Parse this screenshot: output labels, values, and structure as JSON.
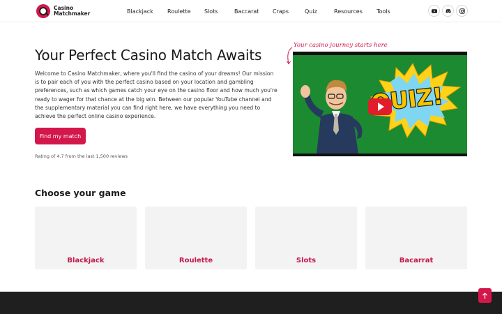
{
  "brand": {
    "name": "Casino Matchmaker",
    "accent": "#d4174b"
  },
  "nav": {
    "items": [
      {
        "label": "Blackjack"
      },
      {
        "label": "Roulette"
      },
      {
        "label": "Slots"
      },
      {
        "label": "Baccarat"
      },
      {
        "label": "Craps"
      },
      {
        "label": "Quiz"
      },
      {
        "label": "Resources"
      },
      {
        "label": "Tools"
      }
    ],
    "social": [
      "youtube-icon",
      "discord-icon",
      "instagram-icon"
    ]
  },
  "hero": {
    "title": "Your Perfect Casino Match Awaits",
    "description": "Welcome to Casino Matchmaker, where you'll find the casino of your dreams! Our mission is to pair each of you with the perfect casino based on your location and gambling preferences, such as which games catch your eye on the casino floor and how much you're ready to wager for that chance at the big win. Between our popular YouTube channel and the supplementary material you can find right here, we have everything you need to achieve the perfect online casino experience.",
    "cta_label": "Find my match",
    "rating_text": "Rating of 4.7 from the last 1,500 reviews"
  },
  "video": {
    "tagline": "Your casino journey starts here",
    "thumbnail_text": "QUIZ!"
  },
  "games": {
    "title": "Choose your game",
    "cards": [
      {
        "label": "Blackjack"
      },
      {
        "label": "Roulette"
      },
      {
        "label": "Slots"
      },
      {
        "label": "Bacarrat"
      }
    ]
  }
}
